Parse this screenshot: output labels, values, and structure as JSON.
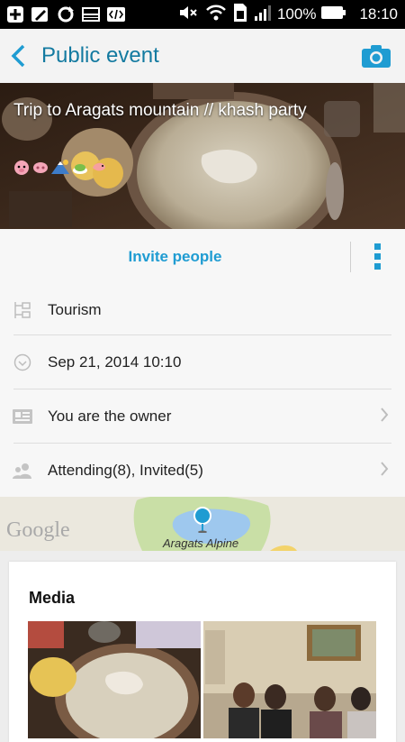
{
  "status_bar": {
    "battery_percent": "100%",
    "time": "18:10",
    "icons": [
      "plus-icon",
      "pen-icon",
      "sync-icon",
      "image-icon",
      "code-icon",
      "mute-icon",
      "wifi-icon",
      "sim-icon",
      "signal-icon",
      "battery-icon"
    ]
  },
  "app_bar": {
    "title": "Public event",
    "back_icon": "chevron-left-icon",
    "camera_icon": "camera-icon"
  },
  "event": {
    "title": "Trip to Aragats mountain  // khash party",
    "emoji": [
      "pig",
      "pig-nose",
      "mountain",
      "tea",
      "shrimp"
    ]
  },
  "actions": {
    "invite_label": "Invite people",
    "more_icon": "kebab-icon"
  },
  "details": {
    "category": "Tourism",
    "datetime": "Sep 21, 2014 10:10",
    "owner": "You are the owner",
    "attendance": "Attending(8), Invited(5)"
  },
  "map": {
    "provider": "Google",
    "place": "Aragats Alpine"
  },
  "media": {
    "title": "Media"
  },
  "colors": {
    "accent": "#1f9cd2",
    "title": "#137aa0"
  }
}
